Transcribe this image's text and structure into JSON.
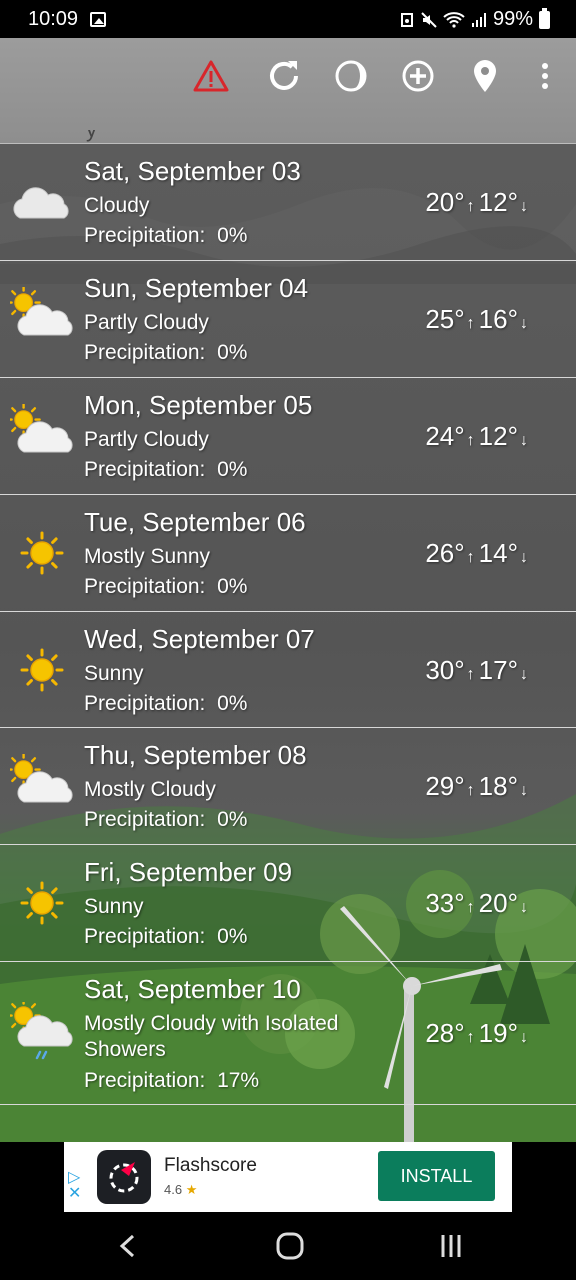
{
  "status_bar": {
    "time": "10:09",
    "battery": "99%",
    "icons": [
      "gallery-icon",
      "data-saver-icon",
      "mute-icon",
      "wifi-icon",
      "signal-icon",
      "battery-icon"
    ]
  },
  "toolbar": {
    "icons": [
      "alert-icon",
      "refresh-icon",
      "moon-phase-icon",
      "add-location-icon",
      "location-pin-icon",
      "overflow-menu-icon"
    ],
    "alert_color": "#d8262b",
    "peek_text": "y"
  },
  "forecast": [
    {
      "date": "Sat, September 03",
      "condition": "Cloudy",
      "precip": "Precipitation:  0%",
      "high": "20°",
      "low": "12°",
      "icon": "cloudy-icon"
    },
    {
      "date": "Sun, September 04",
      "condition": "Partly Cloudy",
      "precip": "Precipitation:  0%",
      "high": "25°",
      "low": "16°",
      "icon": "partly-cloudy-icon"
    },
    {
      "date": "Mon, September 05",
      "condition": "Partly Cloudy",
      "precip": "Precipitation:  0%",
      "high": "24°",
      "low": "12°",
      "icon": "partly-cloudy-icon"
    },
    {
      "date": "Tue, September 06",
      "condition": "Mostly Sunny",
      "precip": "Precipitation:  0%",
      "high": "26°",
      "low": "14°",
      "icon": "sunny-icon"
    },
    {
      "date": "Wed, September 07",
      "condition": "Sunny",
      "precip": "Precipitation:  0%",
      "high": "30°",
      "low": "17°",
      "icon": "sunny-icon"
    },
    {
      "date": "Thu, September 08",
      "condition": "Mostly Cloudy",
      "precip": "Precipitation:  0%",
      "high": "29°",
      "low": "18°",
      "icon": "partly-cloudy-icon"
    },
    {
      "date": "Fri, September 09",
      "condition": "Sunny",
      "precip": "Precipitation:  0%",
      "high": "33°",
      "low": "20°",
      "icon": "sunny-icon"
    },
    {
      "date": "Sat, September 10",
      "condition": "Mostly Cloudy with Isolated Showers",
      "precip": "Precipitation:  17%",
      "high": "28°",
      "low": "19°",
      "icon": "showers-icon"
    }
  ],
  "arrows": {
    "up": "↑",
    "down": "↓"
  },
  "ad": {
    "app_name": "Flashscore",
    "rating": "4.6",
    "star": "★",
    "install_label": "INSTALL",
    "install_color": "#0b7d5c"
  },
  "nav": {
    "icons": [
      "back-icon",
      "home-icon",
      "recents-icon"
    ]
  }
}
